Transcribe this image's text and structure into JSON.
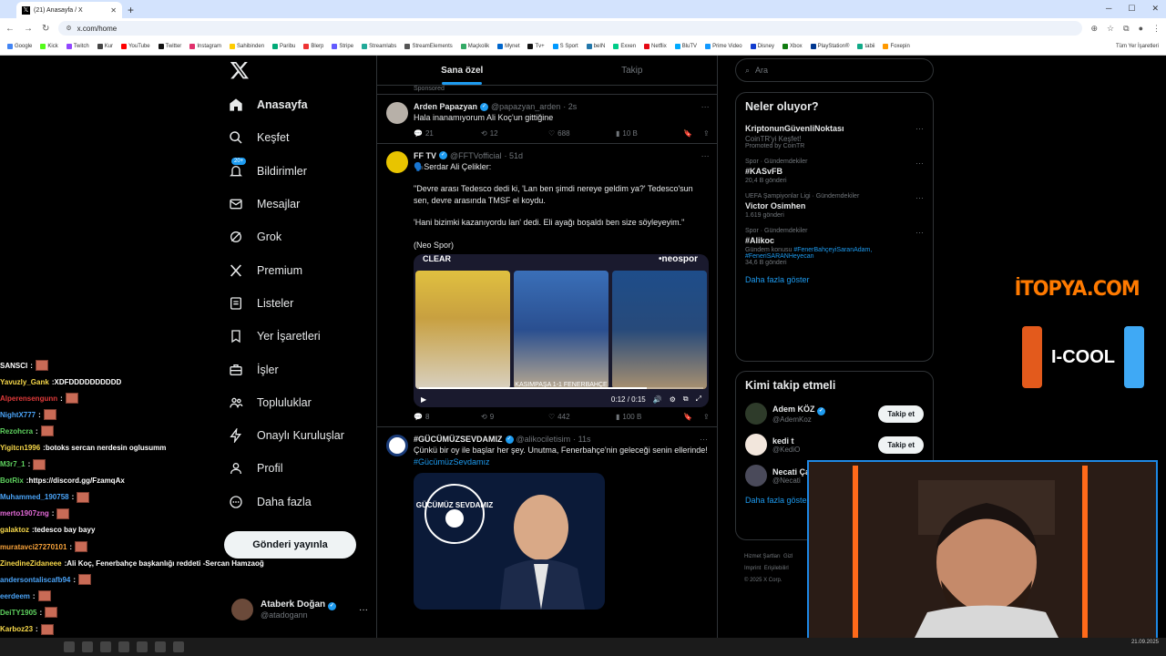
{
  "browser": {
    "tab_title": "(21) Anasayfa / X",
    "url": "x.com/home",
    "bookmarks": [
      "Google",
      "Kick",
      "Twitch",
      "Kur",
      "YouTube",
      "Twitter",
      "Instagram",
      "Sahibinden",
      "Paribu",
      "Blerp",
      "Stripe",
      "Streamlabs",
      "StreamElements",
      "Maçkolik",
      "Mynet",
      "Tv+",
      "S Sport",
      "beIN",
      "Exxen",
      "Netflix",
      "BluTV",
      "Prime Video",
      "Disney",
      "Xbox",
      "PlayStation®",
      "tabii",
      "Foxepin"
    ],
    "all_bookmarks": "Tüm Yer İşaretleri"
  },
  "nav": {
    "items": [
      {
        "label": "Anasayfa",
        "icon": "home-icon"
      },
      {
        "label": "Keşfet",
        "icon": "search-icon"
      },
      {
        "label": "Bildirimler",
        "icon": "bell-icon",
        "badge": "20+"
      },
      {
        "label": "Mesajlar",
        "icon": "mail-icon"
      },
      {
        "label": "Grok",
        "icon": "grok-icon"
      },
      {
        "label": "Premium",
        "icon": "x-premium-icon"
      },
      {
        "label": "Listeler",
        "icon": "list-icon"
      },
      {
        "label": "Yer İşaretleri",
        "icon": "bookmark-icon"
      },
      {
        "label": "İşler",
        "icon": "briefcase-icon"
      },
      {
        "label": "Topluluklar",
        "icon": "people-icon"
      },
      {
        "label": "Onaylı Kuruluşlar",
        "icon": "lightning-icon"
      },
      {
        "label": "Profil",
        "icon": "person-icon"
      },
      {
        "label": "Daha fazla",
        "icon": "more-circle-icon"
      }
    ],
    "post_button": "Gönderi yayınla",
    "account": {
      "name": "Ataberk Doğan",
      "handle": "@atadogann"
    }
  },
  "timeline": {
    "tabs": [
      "Sana özel",
      "Takip"
    ],
    "sponsored": "Sponsored",
    "tweets": [
      {
        "name": "Arden Papazyan",
        "handle": "@papazyan_arden",
        "time": "· 2s",
        "text": "Hala inanamıyorum Ali Koç'un gittiğine",
        "replies": "21",
        "retweets": "12",
        "likes": "688",
        "views": "10 B"
      },
      {
        "name": "FF TV",
        "handle": "@FFTVofficial",
        "time": "· 51d",
        "lines": [
          "🗣️Serdar Ali Çelikler:",
          "\"Devre arası Tedesco dedi ki, 'Lan ben şimdi nereye geldim ya?' Tedesco'sun sen, devre arasında TMSF el koydu.",
          "'Hani bizimki kazanıyordu lan' dedi. Eli ayağı boşaldı ben size söyleyeyim.\"",
          "(Neo Spor)"
        ],
        "video": {
          "logo_left": "CLEAR",
          "logo_right": "•neospor",
          "ticker": "KASIMPAŞA 1-1 FENERBAHÇE",
          "time": "0:12 / 0:15",
          "progress": 0.8
        },
        "replies": "8",
        "retweets": "9",
        "likes": "442",
        "views": "100 B"
      },
      {
        "name": "#GÜCÜMÜZSEVDAMIZ",
        "handle": "@alikociletisim",
        "time": "· 11s",
        "text": "Çünkü bir oy ile başlar her şey. Unutma, Fenerbahçe'nin geleceği senin ellerinde!",
        "hashtag": "#GücümüzSevdamız",
        "image_text": "GÜCÜMÜZ SEVDAMIZ"
      }
    ]
  },
  "right": {
    "search_placeholder": "Ara",
    "trends_title": "Neler oluyor?",
    "trends": [
      {
        "meta": "",
        "title": "KriptonunGüvenliNoktası",
        "sub": "CoinTR'yi Keşfet!",
        "promo": "Promoted by CoinTR"
      },
      {
        "meta": "Spor · Gündemdekiler",
        "title": "#KASvFB",
        "sub": "20,4 B gönderi"
      },
      {
        "meta": "UEFA Şampiyonlar Ligi · Gündemdekiler",
        "title": "Victor Osimhen",
        "sub": "1.619 gönderi"
      },
      {
        "meta": "Spor · Gündemdekiler",
        "title": "#Alikoc",
        "topic": "Gündem konusu",
        "links": "#FenerBahçeyiSaranAdam, #FeneriSARANHeyecan",
        "sub": "34,6 B gönderi"
      }
    ],
    "show_more": "Daha fazla göster",
    "who_title": "Kimi takip etmeli",
    "who": [
      {
        "name": "Adem KÖZ",
        "handle": "@AdemKoz",
        "btn": "Takip et"
      },
      {
        "name": "kedi t",
        "handle": "@KediO",
        "btn": "Takip et"
      },
      {
        "name": "Necati Ça",
        "handle": "@Necati"
      }
    ],
    "footer": [
      "Hizmet Şartları",
      "Gizl",
      "Imprint",
      "Erişilebilirl",
      "© 2025 X Corp."
    ]
  },
  "chat": [
    {
      "user": "SANSCI",
      "color": "#ffffff",
      "text": "",
      "emote": true
    },
    {
      "user": "Yavuzly_Gank",
      "color": "#f7d84a",
      "text": "XDFDDDDDDDDDD"
    },
    {
      "user": "Alperensengunn",
      "color": "#e03a3a",
      "text": "",
      "emote": true
    },
    {
      "user": "NightX777",
      "color": "#4aa3f7",
      "text": "",
      "emote": true
    },
    {
      "user": "Rezohcra",
      "color": "#5fd35f",
      "text": "",
      "emote": true
    },
    {
      "user": "Yigitcn1996",
      "color": "#f7d84a",
      "text": "botoks sercan nerdesin oglusumm"
    },
    {
      "user": "M3r7_1",
      "color": "#5fd35f",
      "text": "",
      "emote": true
    },
    {
      "user": "BotRix",
      "color": "#5fd35f",
      "text": "https://discord.gg/FzamqAx"
    },
    {
      "user": "Muhammed_190758",
      "color": "#4aa3f7",
      "text": "",
      "emote": true
    },
    {
      "user": "merto1907zng",
      "color": "#e36ad8",
      "text": "",
      "emote": true
    },
    {
      "user": "galaktoz",
      "color": "#f7d84a",
      "text": "tedesco bay bayy"
    },
    {
      "user": "muratavci27270101",
      "color": "#f7a23a",
      "text": "",
      "emote": true
    },
    {
      "user": "ZinedineZidaneee",
      "color": "#f7d84a",
      "text": "Ali Koç, Fenerbahçe başkanlığı reddeti -Sercan Hamzaoğ"
    },
    {
      "user": "andersontaliscafb94",
      "color": "#4aa3f7",
      "text": "",
      "emote": true
    },
    {
      "user": "eerdeem",
      "color": "#4aa3f7",
      "text": "",
      "emote": true
    },
    {
      "user": "DeiTY1905",
      "color": "#5fd35f",
      "text": "",
      "emote": true
    },
    {
      "user": "Karboz23",
      "color": "#f7d84a",
      "text": "",
      "emote": true
    }
  ],
  "overlay": {
    "brand": "İTOPYA.COM",
    "cans_text": "I-COOL"
  },
  "clock": "21.09.2025"
}
